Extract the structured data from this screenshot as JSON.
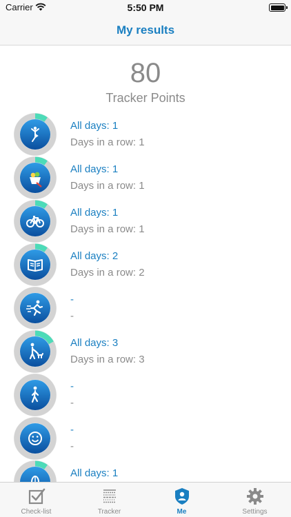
{
  "status_bar": {
    "carrier": "Carrier",
    "time": "5:50 PM"
  },
  "navbar": {
    "title": "My results"
  },
  "summary": {
    "points": "80",
    "points_label": "Tracker Points"
  },
  "trackers": [
    {
      "icon": "yoga-icon",
      "all_days": "All days: 1",
      "in_a_row": "Days in a row: 1",
      "progress": 0.1
    },
    {
      "icon": "healthy-food-icon",
      "all_days": "All days: 1",
      "in_a_row": "Days in a row: 1",
      "progress": 0.1
    },
    {
      "icon": "bicycle-icon",
      "all_days": "All days: 1",
      "in_a_row": "Days in a row: 1",
      "progress": 0.1
    },
    {
      "icon": "book-icon",
      "all_days": "All days: 2",
      "in_a_row": "Days in a row: 2",
      "progress": 0.1
    },
    {
      "icon": "running-icon",
      "all_days": "-",
      "in_a_row": "-",
      "progress": 0
    },
    {
      "icon": "dog-walking-icon",
      "all_days": "All days: 3",
      "in_a_row": "Days in a row: 3",
      "progress": 0.17
    },
    {
      "icon": "walking-icon",
      "all_days": "-",
      "in_a_row": "-",
      "progress": 0
    },
    {
      "icon": "smile-icon",
      "all_days": "-",
      "in_a_row": "-",
      "progress": 0
    },
    {
      "icon": "meditation-icon",
      "all_days": "All days: 1",
      "in_a_row": "",
      "progress": 0.1
    }
  ],
  "tabbar": {
    "tabs": [
      {
        "label": "Check-list",
        "icon": "checklist-icon",
        "active": false
      },
      {
        "label": "Tracker",
        "icon": "tracker-icon",
        "active": false
      },
      {
        "label": "Me",
        "icon": "profile-shield-icon",
        "active": true
      },
      {
        "label": "Settings",
        "icon": "gear-icon",
        "active": false
      }
    ]
  },
  "colors": {
    "accent": "#1a7fc1",
    "progress": "#4ddbb8",
    "ring_track": "#d3d3d3",
    "circle_dark": "#0b4f9e",
    "circle_light": "#2f9be6"
  }
}
